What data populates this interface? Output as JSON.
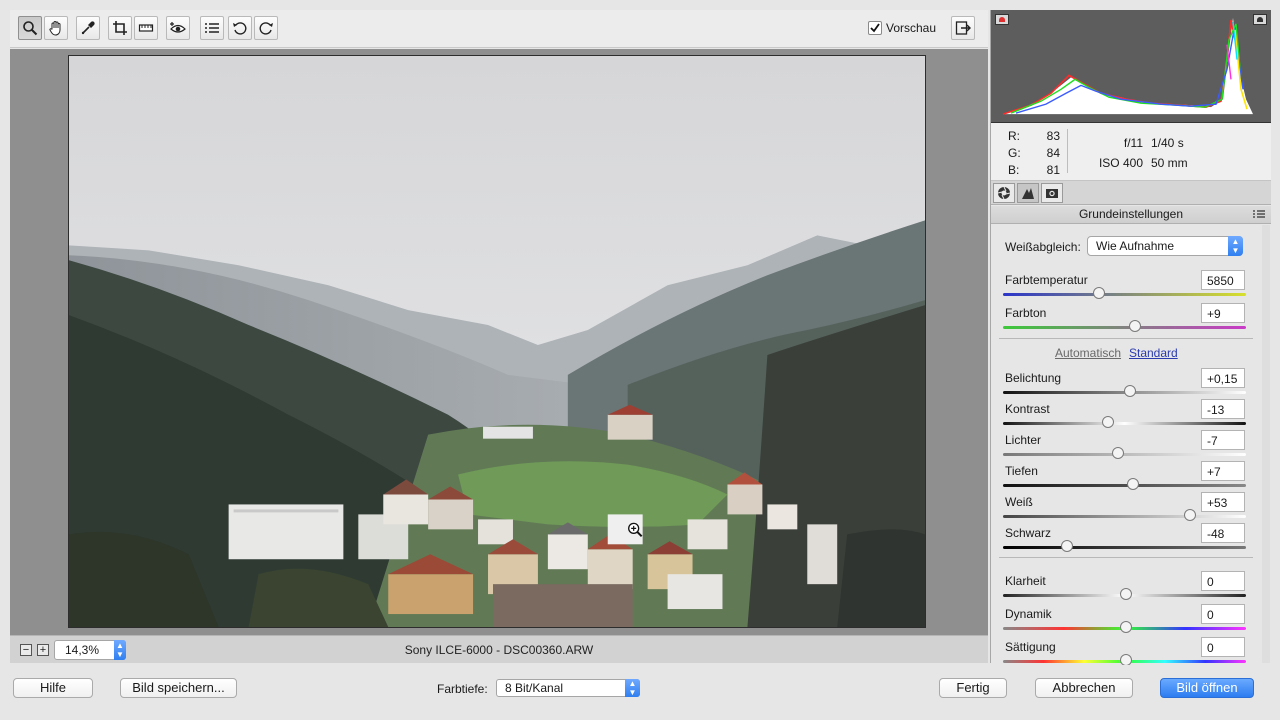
{
  "toolbar": {
    "tools": [
      "zoom-icon",
      "hand-icon",
      "eyedropper-icon",
      "crop-icon",
      "straighten-icon",
      "redeye-icon",
      "list-icon",
      "rotate-left-icon",
      "rotate-right-icon"
    ],
    "preview_label": "Vorschau",
    "preview_checked": true
  },
  "canvas": {
    "zoom": "14,3%",
    "filename": "Sony ILCE-6000 - DSC00360.ARW"
  },
  "info": {
    "r_label": "R:",
    "r_value": "83",
    "g_label": "G:",
    "g_value": "84",
    "b_label": "B:",
    "b_value": "81",
    "aperture": "f/11",
    "shutter": "1/40 s",
    "iso": "ISO 400",
    "focal": "50 mm"
  },
  "panel": {
    "section_title": "Grundeinstellungen",
    "wb_label": "Weißabgleich:",
    "wb_value": "Wie Aufnahme",
    "auto_label": "Automatisch",
    "standard_label": "Standard",
    "sliders": [
      {
        "label": "Farbtemperatur",
        "value": "5850",
        "pos": 0.39
      },
      {
        "label": "Farbton",
        "value": "+9",
        "pos": 0.54
      },
      {
        "label": "Belichtung",
        "value": "+0,15",
        "pos": 0.52
      },
      {
        "label": "Kontrast",
        "value": "-13",
        "pos": 0.43
      },
      {
        "label": "Lichter",
        "value": "-7",
        "pos": 0.47
      },
      {
        "label": "Tiefen",
        "value": "+7",
        "pos": 0.53
      },
      {
        "label": "Weiß",
        "value": "+53",
        "pos": 0.765
      },
      {
        "label": "Schwarz",
        "value": "-48",
        "pos": 0.26
      },
      {
        "label": "Klarheit",
        "value": "0",
        "pos": 0.5
      },
      {
        "label": "Dynamik",
        "value": "0",
        "pos": 0.5
      },
      {
        "label": "Sättigung",
        "value": "0",
        "pos": 0.5
      }
    ]
  },
  "bottom": {
    "help_label": "Hilfe",
    "save_label": "Bild speichern...",
    "depth_label": "Farbtiefe:",
    "depth_value": "8 Bit/Kanal",
    "done_label": "Fertig",
    "cancel_label": "Abbrechen",
    "open_label": "Bild öffnen"
  },
  "colors": {
    "accent": "#2c7cf0",
    "canvas_bg": "#8f8f8f",
    "histogram_bg": "#5d5d5d"
  }
}
